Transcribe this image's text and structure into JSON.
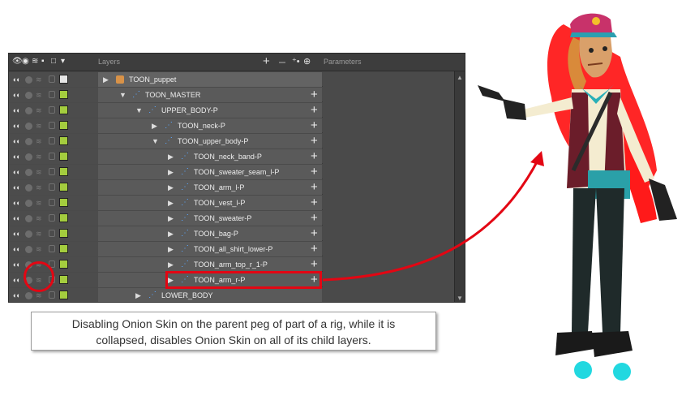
{
  "panel": {
    "layers_header": "Layers",
    "parameters_header": "Parameters"
  },
  "layers": [
    {
      "name": "TOON_puppet",
      "swatch": "white"
    },
    {
      "name": "TOON_MASTER",
      "swatch": "green"
    },
    {
      "name": "UPPER_BODY-P",
      "swatch": "green"
    },
    {
      "name": "TOON_neck-P",
      "swatch": "green"
    },
    {
      "name": "TOON_upper_body-P",
      "swatch": "green"
    },
    {
      "name": "TOON_neck_band-P",
      "swatch": "green"
    },
    {
      "name": "TOON_sweater_seam_l-P",
      "swatch": "green"
    },
    {
      "name": "TOON_arm_l-P",
      "swatch": "green"
    },
    {
      "name": "TOON_vest_l-P",
      "swatch": "green"
    },
    {
      "name": "TOON_sweater-P",
      "swatch": "green"
    },
    {
      "name": "TOON_bag-P",
      "swatch": "green"
    },
    {
      "name": "TOON_all_shirt_lower-P",
      "swatch": "green"
    },
    {
      "name": "TOON_arm_top_r_1-P",
      "swatch": "green"
    },
    {
      "name": "TOON_arm_r-P",
      "swatch": "green"
    },
    {
      "name": "LOWER_BODY",
      "swatch": "green"
    }
  ],
  "caption": {
    "line1": "Disabling Onion Skin on the parent peg of part of a rig, while it is",
    "line2": "collapsed, disables Onion Skin on all of its child layers."
  },
  "colors": {
    "highlight": "#e30613",
    "layer_swatch": "#a4cd3e",
    "peg_icon": "#5aa7ff"
  },
  "icons": [
    "eye-icon",
    "onion-skin-icon",
    "lock-icon",
    "add-layer-icon",
    "peg-icon",
    "expand-triangle-icon"
  ]
}
